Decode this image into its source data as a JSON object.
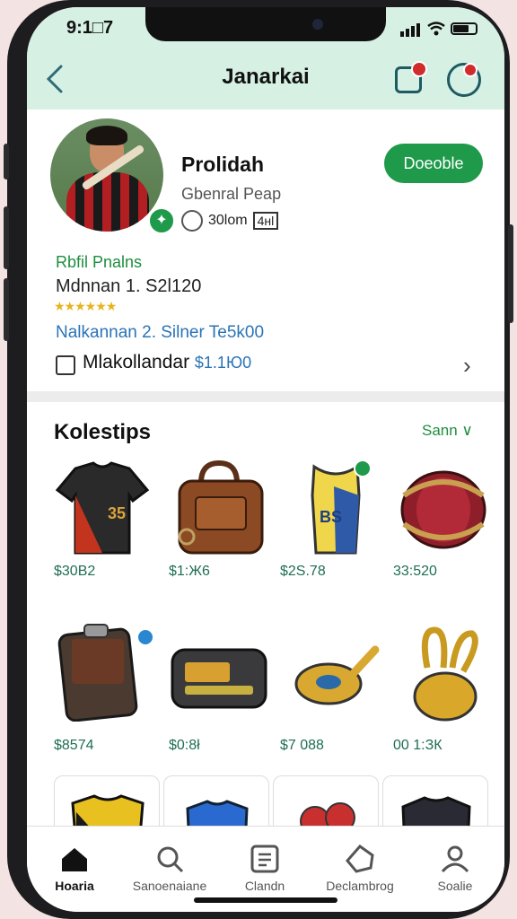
{
  "status_bar": {
    "time": "9:1□7"
  },
  "header": {
    "title": "Janarkai"
  },
  "profile": {
    "name": "Prolidah",
    "subtitle": "Gbenral Peap",
    "stat": "30lom",
    "stat_box": "4нl",
    "action_button": "Doeoble"
  },
  "details": {
    "rank_label": "Rbfil Pnalns",
    "member_line": "Mdnnan 1. S2l120",
    "stars": "★★★★★★",
    "blue_line": "Nalkannan 2. Silner Te5k00",
    "row_label": "Mlakollandar",
    "row_value": "$1.1Ю0"
  },
  "collection": {
    "title": "Kolestips",
    "link": "Sann ∨",
    "items": [
      {
        "name": "jersey",
        "price": "$30В2"
      },
      {
        "name": "bag",
        "price": "$1:Ж6"
      },
      {
        "name": "tank-top",
        "price": "$2Ѕ.78"
      },
      {
        "name": "drum",
        "price": "33:520"
      },
      {
        "name": "wallet",
        "price": "$8574"
      },
      {
        "name": "device",
        "price": "$0:8ł"
      },
      {
        "name": "badge",
        "price": "$7 088"
      },
      {
        "name": "trophy",
        "price": "00 1:ЗК"
      }
    ]
  },
  "tabs": [
    {
      "label": "Hoaria"
    },
    {
      "label": "Sanoenaiane"
    },
    {
      "label": "Clandn"
    },
    {
      "label": "Declambrog"
    },
    {
      "label": "Soalie"
    }
  ],
  "colors": {
    "accent": "#1e9a4a",
    "header_bg": "#d6f0e3",
    "link_blue": "#2a74b6"
  }
}
